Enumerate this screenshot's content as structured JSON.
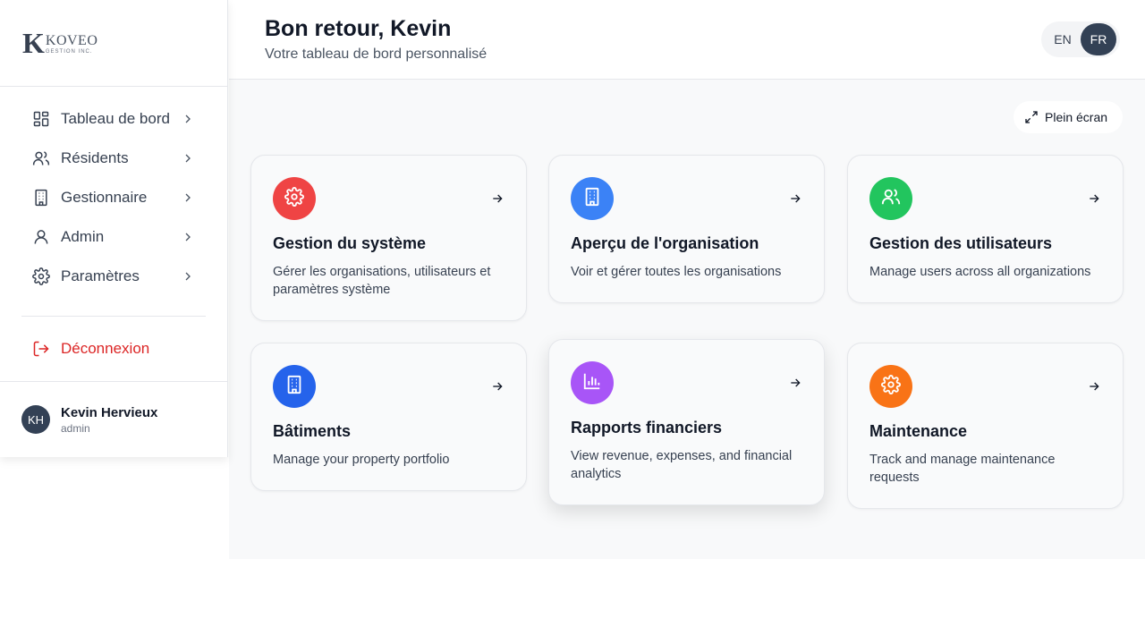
{
  "logo": {
    "letter": "K",
    "name": "KOVEO",
    "sub": "GESTION INC."
  },
  "sidebar": {
    "items": [
      {
        "label": "Tableau de bord",
        "icon": "dashboard-icon"
      },
      {
        "label": "Résidents",
        "icon": "users-icon"
      },
      {
        "label": "Gestionnaire",
        "icon": "building-icon"
      },
      {
        "label": "Admin",
        "icon": "user-icon"
      },
      {
        "label": "Paramètres",
        "icon": "gear-icon"
      }
    ],
    "logout": "Déconnexion",
    "user": {
      "initials": "KH",
      "name": "Kevin Hervieux",
      "role": "admin"
    }
  },
  "header": {
    "title": "Bon retour, Kevin",
    "subtitle": "Votre tableau de bord personnalisé",
    "lang": {
      "en": "EN",
      "fr": "FR",
      "active": "FR"
    }
  },
  "main": {
    "fullscreen": "Plein écran",
    "cards": [
      {
        "title": "Gestion du système",
        "desc": "Gérer les organisations, utilisateurs et paramètres système",
        "color": "#ef4444",
        "icon": "gear-icon"
      },
      {
        "title": "Aperçu de l'organisation",
        "desc": "Voir et gérer toutes les organisations",
        "color": "#3b82f6",
        "icon": "building-icon"
      },
      {
        "title": "Gestion des utilisateurs",
        "desc": "Manage users across all organizations",
        "color": "#22c55e",
        "icon": "users-icon"
      },
      {
        "title": "Bâtiments",
        "desc": "Manage your property portfolio",
        "color": "#2563eb",
        "icon": "building-icon"
      },
      {
        "title": "Rapports financiers",
        "desc": "View revenue, expenses, and financial analytics",
        "color": "#a855f7",
        "icon": "bar-chart-icon"
      },
      {
        "title": "Maintenance",
        "desc": "Track and manage maintenance requests",
        "color": "#f97316",
        "icon": "gear-icon"
      }
    ]
  }
}
